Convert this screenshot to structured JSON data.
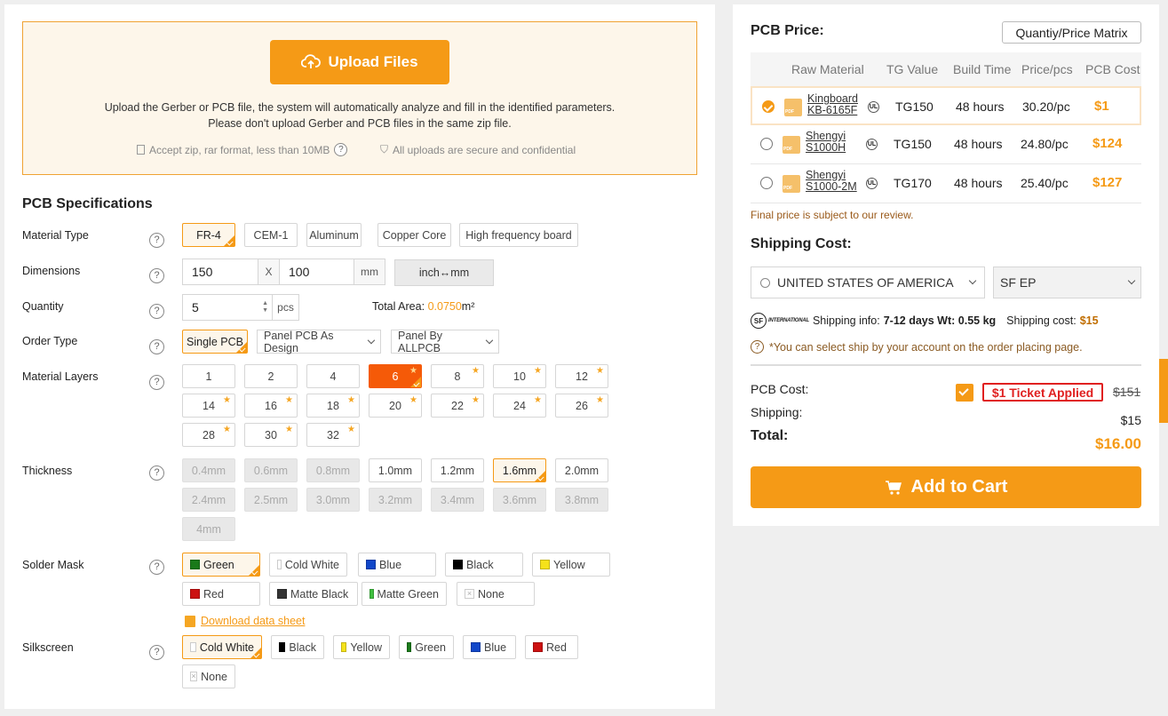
{
  "upload": {
    "button_label": "Upload Files",
    "desc_line1": "Upload the Gerber or PCB file, the system will automatically analyze and fill in the identified parameters.",
    "desc_line2": "Please don't upload Gerber and PCB files in the same zip file.",
    "note_format": "Accept zip, rar format, less than 10MB",
    "note_secure": "All uploads are secure and confidential"
  },
  "spec": {
    "title": "PCB Specifications",
    "material_type": {
      "label": "Material Type",
      "options": [
        "FR-4",
        "CEM-1",
        "Aluminum",
        "Copper Core",
        "High frequency board"
      ],
      "selected": "FR-4"
    },
    "dimensions": {
      "label": "Dimensions",
      "width": "150",
      "separator": "X",
      "height": "100",
      "unit": "mm",
      "toggle": "inch↔mm"
    },
    "quantity": {
      "label": "Quantity",
      "value": "5",
      "unit": "pcs",
      "area_label": "Total Area:",
      "area_value": "0.0750",
      "area_unit": "m²"
    },
    "order_type": {
      "label": "Order Type",
      "selected": "Single PCB",
      "panel_design": "Panel PCB As Design",
      "panel_allpcb": "Panel By ALLPCB"
    },
    "layers": {
      "label": "Material Layers",
      "options": [
        "1",
        "2",
        "4",
        "6",
        "8",
        "10",
        "12",
        "14",
        "16",
        "18",
        "20",
        "22",
        "24",
        "26",
        "28",
        "30",
        "32"
      ],
      "selected": "6"
    },
    "thickness": {
      "label": "Thickness",
      "options": [
        "0.4mm",
        "0.6mm",
        "0.8mm",
        "1.0mm",
        "1.2mm",
        "1.6mm",
        "2.0mm",
        "2.4mm",
        "2.5mm",
        "3.0mm",
        "3.2mm",
        "3.4mm",
        "3.6mm",
        "3.8mm",
        "4mm"
      ],
      "selected": "1.6mm"
    },
    "solder_mask": {
      "label": "Solder Mask",
      "options": [
        {
          "name": "Green",
          "color": "#1a7a1a"
        },
        {
          "name": "Cold White",
          "color": "#ffffff"
        },
        {
          "name": "Blue",
          "color": "#1147c9"
        },
        {
          "name": "Black",
          "color": "#000000"
        },
        {
          "name": "Yellow",
          "color": "#f5e21a"
        },
        {
          "name": "Red",
          "color": "#cc1111"
        },
        {
          "name": "Matte Black",
          "color": "#333333"
        },
        {
          "name": "Matte Green",
          "color": "#3fbf3f"
        },
        {
          "name": "None",
          "color": ""
        }
      ],
      "selected": "Green",
      "datasheet": "Download data sheet"
    },
    "silkscreen": {
      "label": "Silkscreen",
      "options": [
        {
          "name": "Cold White",
          "color": "#ffffff"
        },
        {
          "name": "Black",
          "color": "#000000"
        },
        {
          "name": "Yellow",
          "color": "#f5e21a"
        },
        {
          "name": "Green",
          "color": "#1a7a1a"
        },
        {
          "name": "Blue",
          "color": "#1147c9"
        },
        {
          "name": "Red",
          "color": "#cc1111"
        },
        {
          "name": "None",
          "color": ""
        }
      ],
      "selected": "Cold White"
    }
  },
  "price": {
    "title": "PCB Price:",
    "matrix_button": "Quantiy/Price Matrix",
    "columns": [
      "Raw Material",
      "TG Value",
      "Build Time",
      "Price/pcs",
      "PCB Cost"
    ],
    "rows": [
      {
        "material_1": "Kingboard",
        "material_2": "KB-6165F",
        "tg": "TG150",
        "build": "48 hours",
        "price": "30.20/pc",
        "cost": "$1",
        "selected": true
      },
      {
        "material_1": "Shengyi",
        "material_2": "S1000H",
        "tg": "TG150",
        "build": "48 hours",
        "price": "24.80/pc",
        "cost": "$124",
        "selected": false
      },
      {
        "material_1": "Shengyi",
        "material_2": "S1000-2M",
        "tg": "TG170",
        "build": "48 hours",
        "price": "25.40/pc",
        "cost": "$127",
        "selected": false
      }
    ],
    "review_note": "Final price is subject to our review."
  },
  "shipping": {
    "title": "Shipping Cost:",
    "country": "UNITED STATES OF AMERICA",
    "method": "SF EP",
    "carrier_logo": "SF",
    "carrier_sub": "INTERNATIONAL",
    "info_label": "Shipping info:",
    "info_value": "7-12 days Wt: 0.55 kg",
    "cost_label": "Shipping cost:",
    "cost_value": "$15",
    "account_note": "*You can select ship by your account on the order placing page."
  },
  "summary": {
    "pcb_cost_label": "PCB Cost:",
    "ticket": "$1 Ticket Applied",
    "original": "$151",
    "shipping_label": "Shipping:",
    "shipping_value": "$15",
    "total_label": "Total:",
    "total_value": "$16.00",
    "cart_button": "Add to Cart"
  },
  "colors": {
    "accent": "#f59a16",
    "hot": "#f55a08"
  }
}
